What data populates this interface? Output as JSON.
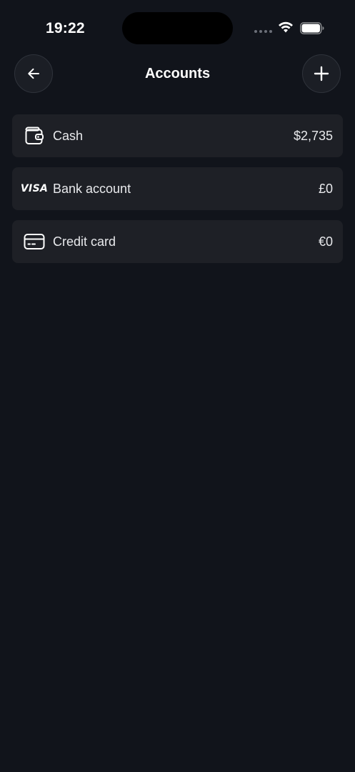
{
  "status_bar": {
    "time": "19:22",
    "icons": [
      "signal-dots-icon",
      "wifi-icon",
      "battery-icon"
    ]
  },
  "header": {
    "title": "Accounts",
    "back_icon": "arrow-left-icon",
    "add_icon": "plus-icon"
  },
  "accounts": [
    {
      "name": "Cash",
      "amount": "$2,735",
      "icon": "wallet-icon"
    },
    {
      "name": "Bank account",
      "amount": "£0",
      "icon": "visa-icon",
      "icon_text": "VISA"
    },
    {
      "name": "Credit card",
      "amount": "€0",
      "icon": "credit-card-icon"
    }
  ],
  "colors": {
    "background": "#11141b",
    "card": "#1e2026",
    "button": "#1b1e25",
    "text": "#ffffff"
  }
}
